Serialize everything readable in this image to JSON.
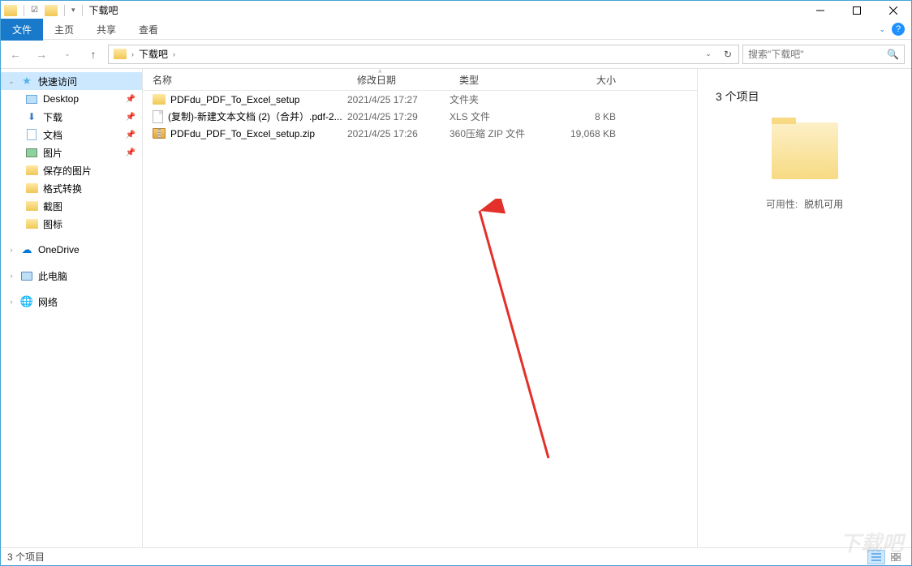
{
  "window": {
    "title": "下载吧"
  },
  "ribbon": {
    "tabs": [
      "文件",
      "主页",
      "共享",
      "查看"
    ]
  },
  "breadcrumb": {
    "segments": [
      "下载吧"
    ]
  },
  "search": {
    "placeholder": "搜索\"下载吧\""
  },
  "sidebar": {
    "quick_access": "快速访问",
    "items": [
      "Desktop",
      "下载",
      "文档",
      "图片",
      "保存的图片",
      "格式转换",
      "截图",
      "图标"
    ],
    "onedrive": "OneDrive",
    "this_pc": "此电脑",
    "network": "网络"
  },
  "columns": {
    "name": "名称",
    "date": "修改日期",
    "type": "类型",
    "size": "大小"
  },
  "files": [
    {
      "name": "PDFdu_PDF_To_Excel_setup",
      "date": "2021/4/25 17:27",
      "type": "文件夹",
      "size": "",
      "icon": "folder"
    },
    {
      "name": "(复制)-新建文本文档 (2)（合并）.pdf-2...",
      "date": "2021/4/25 17:29",
      "type": "XLS 文件",
      "size": "8 KB",
      "icon": "file"
    },
    {
      "name": "PDFdu_PDF_To_Excel_setup.zip",
      "date": "2021/4/25 17:26",
      "type": "360压缩 ZIP 文件",
      "size": "19,068 KB",
      "icon": "zip"
    }
  ],
  "details": {
    "title": "3 个项目",
    "avail_label": "可用性:",
    "avail_value": "脱机可用"
  },
  "status": {
    "text": "3 个项目"
  },
  "watermark": "下载吧"
}
